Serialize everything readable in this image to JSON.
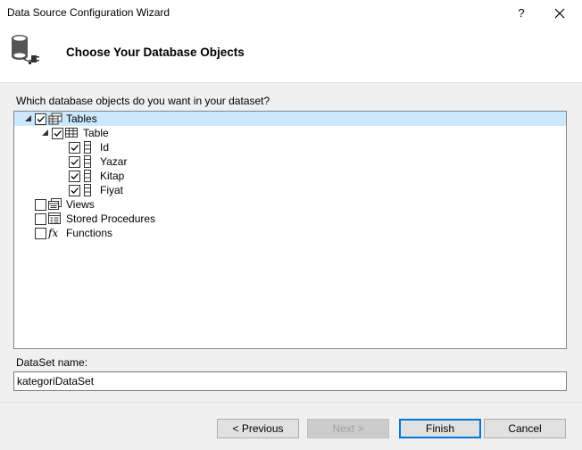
{
  "window": {
    "title": "Data Source Configuration Wizard",
    "help_label": "?"
  },
  "header": {
    "title": "Choose Your Database Objects",
    "icon": "database-connect-icon"
  },
  "prompt": "Which database objects do you want in your dataset?",
  "tree": {
    "tables": {
      "label": "Tables",
      "checked": true,
      "expanded": true,
      "selected": true
    },
    "table": {
      "label": "Table",
      "checked": true,
      "expanded": true
    },
    "columns": [
      {
        "label": "Id",
        "checked": true
      },
      {
        "label": "Yazar",
        "checked": true
      },
      {
        "label": "Kitap",
        "checked": true
      },
      {
        "label": "Fiyat",
        "checked": true
      }
    ],
    "views": {
      "label": "Views",
      "checked": false
    },
    "stored_procedures": {
      "label": "Stored Procedures",
      "checked": false
    },
    "functions": {
      "label": "Functions",
      "checked": false,
      "icon_text": "fx"
    }
  },
  "dataset": {
    "label": "DataSet name:",
    "value": "kategoriDataSet"
  },
  "buttons": {
    "previous": "< Previous",
    "next": "Next >",
    "finish": "Finish",
    "cancel": "Cancel"
  }
}
